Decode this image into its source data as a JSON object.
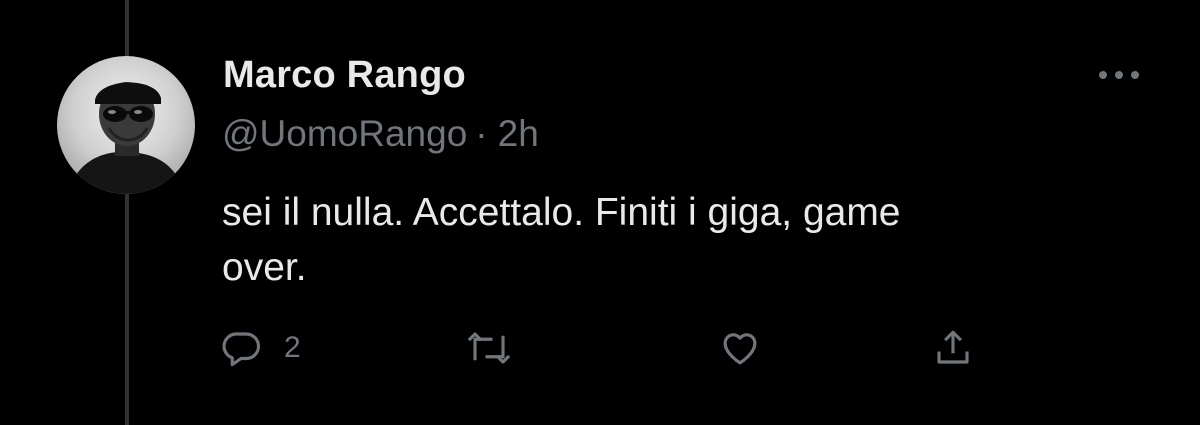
{
  "tweet": {
    "display_name": "Marco Rango",
    "handle": "@UomoRango",
    "separator": "·",
    "timestamp": "2h",
    "text": "sei il nulla. Accettalo. Finiti i giga, game\nover.",
    "avatar_icon": "profile-photo",
    "actions": {
      "reply": {
        "icon": "reply-icon",
        "count": "2"
      },
      "retweet": {
        "icon": "retweet-icon",
        "count": ""
      },
      "like": {
        "icon": "heart-icon",
        "count": ""
      },
      "share": {
        "icon": "share-icon",
        "count": ""
      }
    },
    "more_icon": "more-options-icon"
  },
  "colors": {
    "background": "#000000",
    "primary_text": "#e7e9ea",
    "secondary_text": "#71767b",
    "thread_line": "#2f3336"
  }
}
